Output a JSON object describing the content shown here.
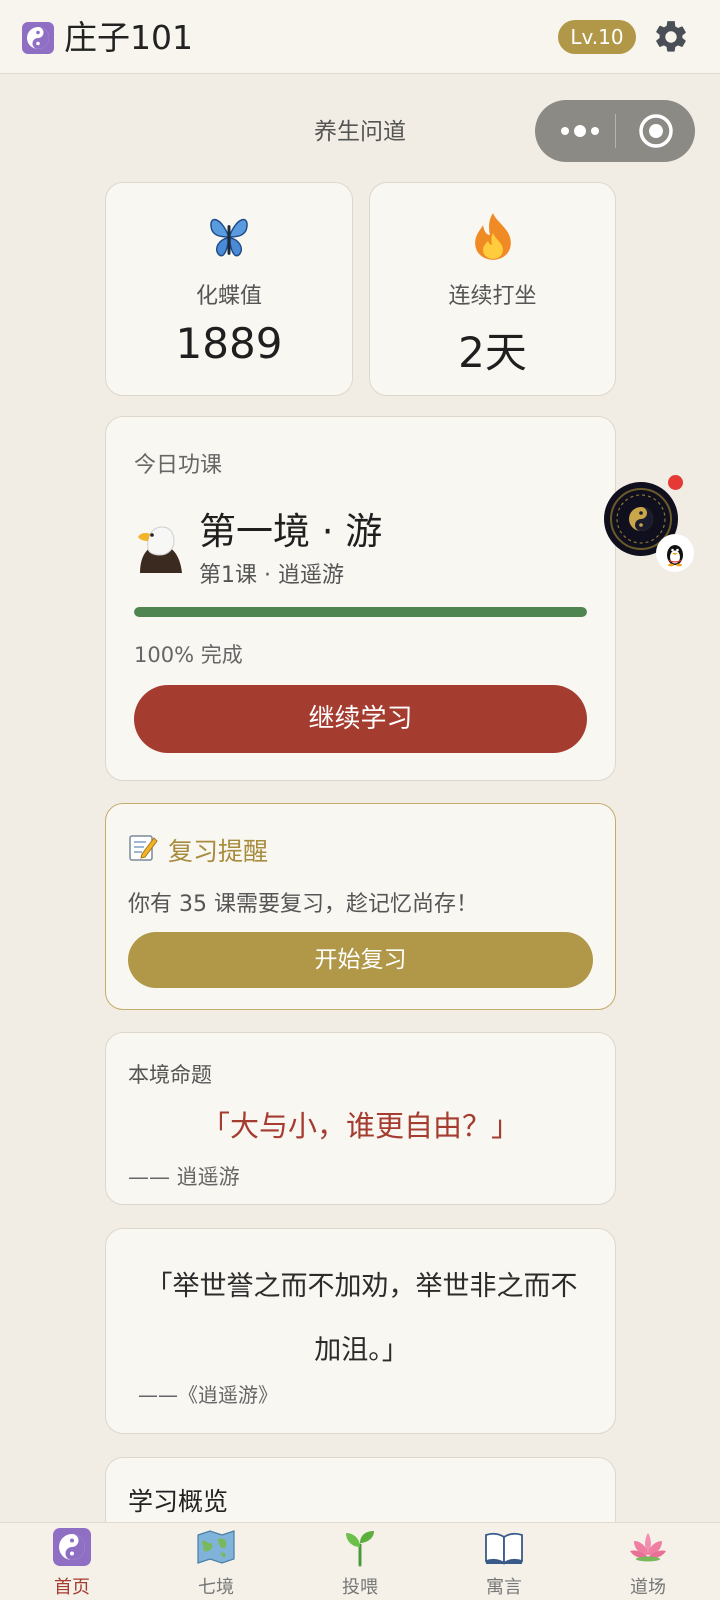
{
  "header": {
    "app_title": "庄子101",
    "level": "Lv.10",
    "logo_icon": "yin-yang-icon",
    "settings_icon": "gear-icon"
  },
  "subtitle": "养生问道",
  "stats": {
    "butterfly": {
      "label": "化蝶值",
      "value": "1889",
      "icon": "butterfly-icon"
    },
    "streak": {
      "label": "连续打坐",
      "value": "2天",
      "icon": "fire-icon"
    }
  },
  "lesson": {
    "heading": "今日功课",
    "realm_title": "第一境 · 游",
    "subtitle": "第1课 · 逍遥游",
    "progress": 100,
    "progress_text": "100% 完成",
    "button": "继续学习"
  },
  "review": {
    "title": "复习提醒",
    "description": "你有 35 课需要复习，趁记忆尚存！",
    "button": "开始复习"
  },
  "theme": {
    "label": "本境命题",
    "question": "「大与小，谁更自由？」",
    "source": "—— 逍遥游"
  },
  "quote": {
    "text": "「举世誉之而不加劝，举世非之而不加沮。」",
    "source": "——《逍遥游》"
  },
  "overview": {
    "title": "学习概览"
  },
  "tabs": [
    {
      "label": "首页",
      "icon": "yin-yang-icon",
      "active": true
    },
    {
      "label": "七境",
      "icon": "map-icon",
      "active": false
    },
    {
      "label": "投喂",
      "icon": "sprout-icon",
      "active": false
    },
    {
      "label": "寓言",
      "icon": "book-icon",
      "active": false
    },
    {
      "label": "道场",
      "icon": "lotus-icon",
      "active": false
    }
  ],
  "colors": {
    "accent_red": "#a53c30",
    "gold": "#b09848",
    "progress_green": "#4e8551",
    "background": "#f1ede5"
  }
}
